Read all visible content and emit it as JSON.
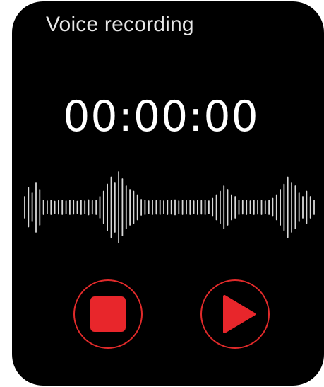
{
  "app": {
    "title": "Voice recording",
    "timer": "00:00:00"
  },
  "waveform": {
    "amplitudes": [
      0.3,
      0.55,
      0.4,
      0.7,
      0.5,
      0.2,
      0.18,
      0.2,
      0.17,
      0.19,
      0.2,
      0.18,
      0.2,
      0.19,
      0.17,
      0.2,
      0.18,
      0.21,
      0.19,
      0.2,
      0.3,
      0.45,
      0.65,
      0.85,
      0.7,
      1.0,
      0.8,
      0.6,
      0.5,
      0.45,
      0.35,
      0.22,
      0.2,
      0.18,
      0.2,
      0.19,
      0.2,
      0.18,
      0.2,
      0.19,
      0.21,
      0.18,
      0.2,
      0.19,
      0.2,
      0.18,
      0.2,
      0.19,
      0.2,
      0.18,
      0.25,
      0.35,
      0.45,
      0.6,
      0.5,
      0.35,
      0.3,
      0.2,
      0.19,
      0.2,
      0.18,
      0.2,
      0.19,
      0.2,
      0.18,
      0.2,
      0.25,
      0.35,
      0.5,
      0.65,
      0.85,
      0.7,
      0.6,
      0.4,
      0.3,
      0.45,
      0.3,
      0.2
    ],
    "color": "#d8d8d8"
  },
  "controls": {
    "stop": {
      "icon": "stop-icon",
      "color": "#e8262b"
    },
    "play": {
      "icon": "play-icon",
      "color": "#e8262b"
    }
  },
  "colors": {
    "background": "#000000",
    "accent": "#e8262b",
    "text": "#ffffff"
  }
}
